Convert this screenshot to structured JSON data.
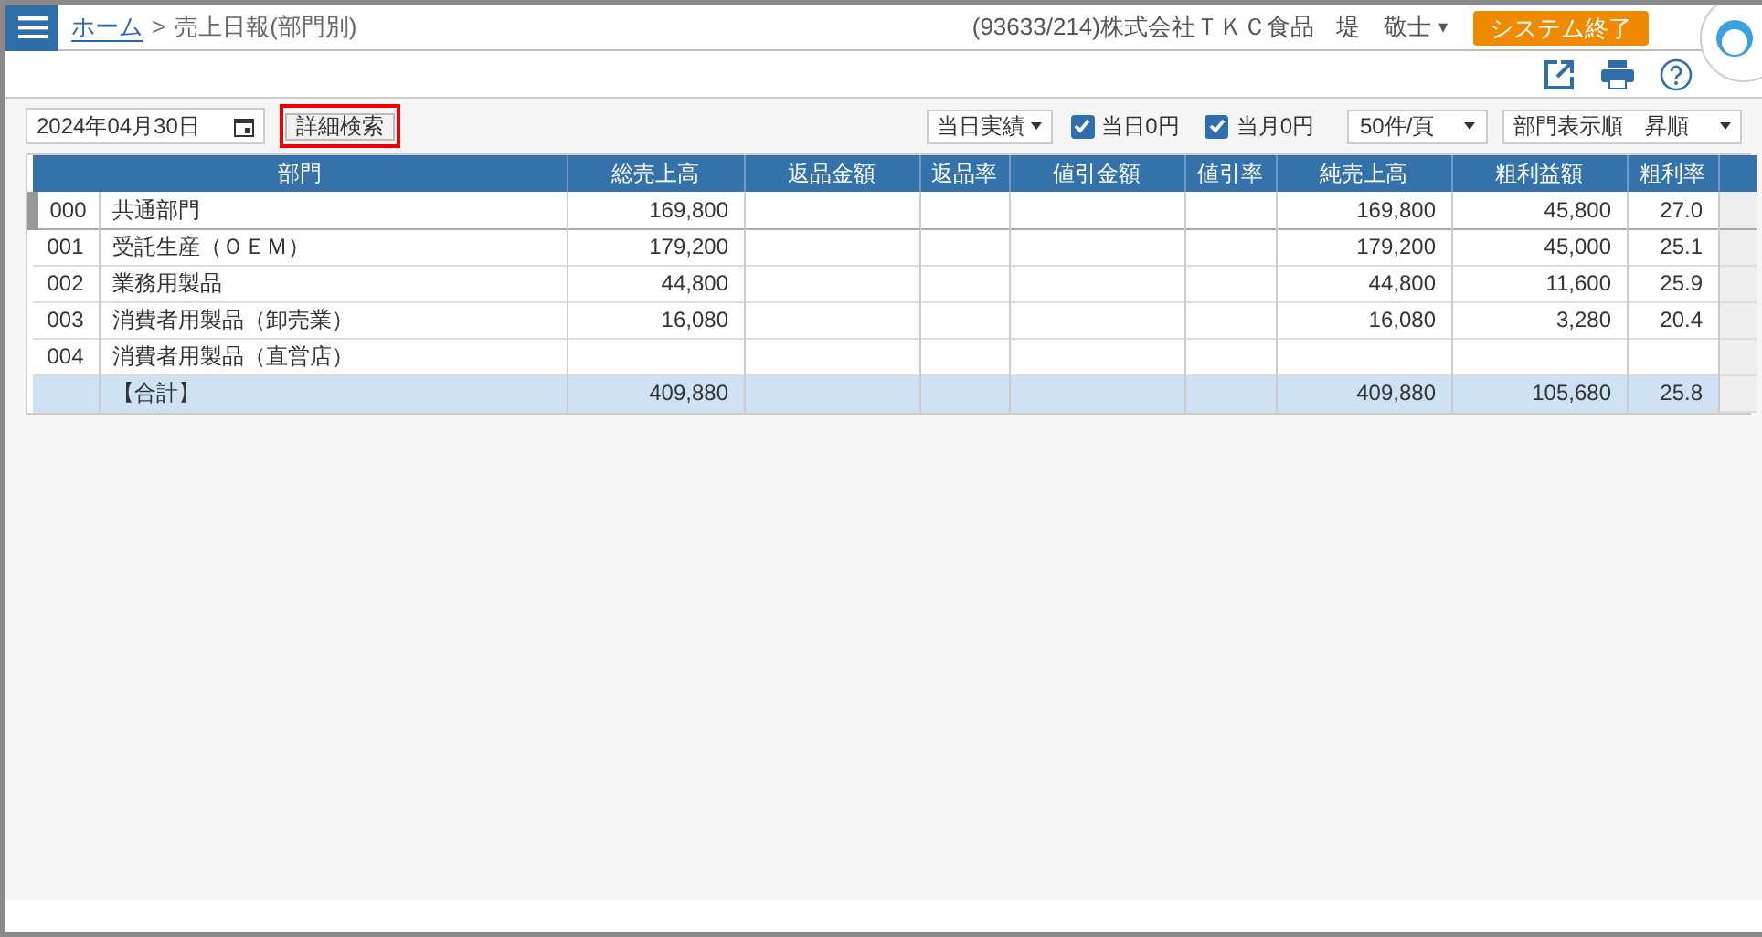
{
  "header": {
    "breadcrumb_home": "ホーム",
    "breadcrumb_separator": ">",
    "page_title": "売上日報(部門別)",
    "company": "(93633/214)株式会社ＴＫＣ食品",
    "user": "堤　敬士",
    "user_caret": "▾",
    "exit_button": "システム終了"
  },
  "filters": {
    "date": "2024年04月30日",
    "detail_search": "詳細検索",
    "period": "当日実績",
    "checkboxes": [
      {
        "label": "当日0円",
        "checked": true
      },
      {
        "label": "当月0円",
        "checked": true
      }
    ],
    "page_size": "50件/頁",
    "sort": "部門表示順　昇順"
  },
  "table": {
    "columns": [
      {
        "label": "部門",
        "colspan": 2
      },
      {
        "label": "総売上高"
      },
      {
        "label": "返品金額"
      },
      {
        "label": "返品率"
      },
      {
        "label": "値引金額"
      },
      {
        "label": "値引率"
      },
      {
        "label": "純売上高"
      },
      {
        "label": "粗利益額"
      },
      {
        "label": "粗利率"
      }
    ],
    "rows": [
      {
        "kind": "data",
        "selected": true,
        "cells": [
          "000",
          "共通部門",
          "169,800",
          "",
          "",
          "",
          "",
          "169,800",
          "45,800",
          "27.0"
        ]
      },
      {
        "kind": "data",
        "selected": false,
        "cells": [
          "001",
          "受託生産（ＯＥＭ）",
          "179,200",
          "",
          "",
          "",
          "",
          "179,200",
          "45,000",
          "25.1"
        ]
      },
      {
        "kind": "data",
        "selected": false,
        "cells": [
          "002",
          "業務用製品",
          "44,800",
          "",
          "",
          "",
          "",
          "44,800",
          "11,600",
          "25.9"
        ]
      },
      {
        "kind": "data",
        "selected": false,
        "cells": [
          "003",
          "消費者用製品（卸売業）",
          "16,080",
          "",
          "",
          "",
          "",
          "16,080",
          "3,280",
          "20.4"
        ]
      },
      {
        "kind": "data",
        "selected": false,
        "cells": [
          "004",
          "消費者用製品（直営店）",
          "",
          "",
          "",
          "",
          "",
          "",
          "",
          ""
        ]
      },
      {
        "kind": "total",
        "selected": false,
        "cells": [
          "",
          "【合計】",
          "409,880",
          "",
          "",
          "",
          "",
          "409,880",
          "105,680",
          "25.8"
        ]
      }
    ]
  }
}
